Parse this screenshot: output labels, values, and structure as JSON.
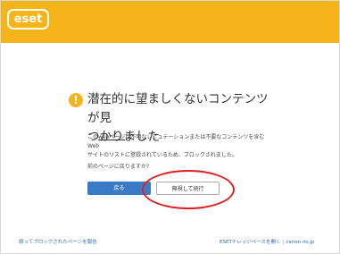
{
  "header": {
    "logo_text": "eset",
    "brand_color": "#f5b41a"
  },
  "main": {
    "title_line1": "潜在的に望ましくないコンテンツが見",
    "title_line2": "つかりました",
    "desc_prefix": "この",
    "desc_link": "webページ",
    "desc_line1_rest": "は不明なレピュテーションまたは不要なコンテンツを含むWeb",
    "desc_line2": "サイトのリストに登録されているため、ブロックされました。",
    "question": "前のページに戻りますか?",
    "back_button": "戻る",
    "ignore_button": "無視して続行"
  },
  "footer": {
    "report_link": "誤ってブロックされたページを報告",
    "kb_link": "ESETナレッジベースを開く",
    "separator": "|",
    "domain": "canon-its.jp"
  },
  "colors": {
    "accent": "#f5b41a",
    "primary_button": "#3a7bc8",
    "highlight_circle": "#e02020"
  },
  "icons": {
    "warning": "exclamation-circle-icon"
  }
}
